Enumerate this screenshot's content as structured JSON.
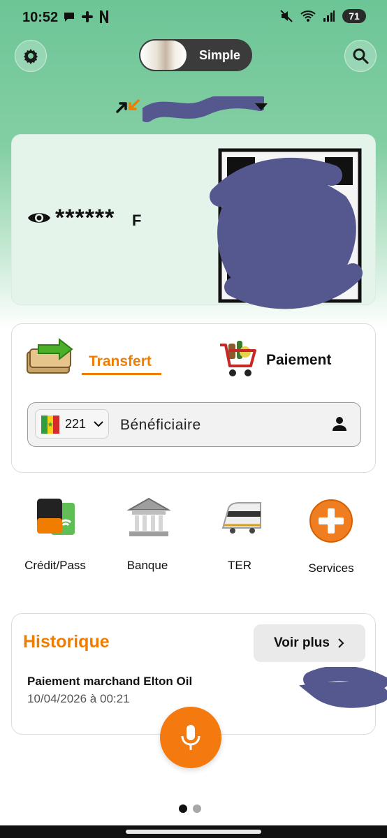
{
  "status_bar": {
    "time": "10:52",
    "battery": "71"
  },
  "header": {
    "mode_label": "Simple"
  },
  "balance": {
    "value": "******",
    "currency": "F"
  },
  "transfer_card": {
    "tabs": [
      {
        "label": "Transfert",
        "active": true
      },
      {
        "label": "Paiement",
        "active": false
      }
    ],
    "country_code": "221",
    "beneficiary_placeholder": "Bénéficiaire"
  },
  "shortcuts": [
    {
      "label": "Crédit/Pass",
      "icon": "credit-pass-icon"
    },
    {
      "label": "Banque",
      "icon": "bank-icon"
    },
    {
      "label": "TER",
      "icon": "train-icon"
    },
    {
      "label": "Services",
      "icon": "plus-icon"
    }
  ],
  "history": {
    "title": "Historique",
    "see_more_label": "Voir plus",
    "items": [
      {
        "title": "Paiement marchand Elton Oil",
        "date": "10/04/2026 à 00:21"
      }
    ]
  },
  "colors": {
    "brand_orange": "#f07d00",
    "header_green": "#6cc596",
    "redaction_purple": "#55588f"
  }
}
